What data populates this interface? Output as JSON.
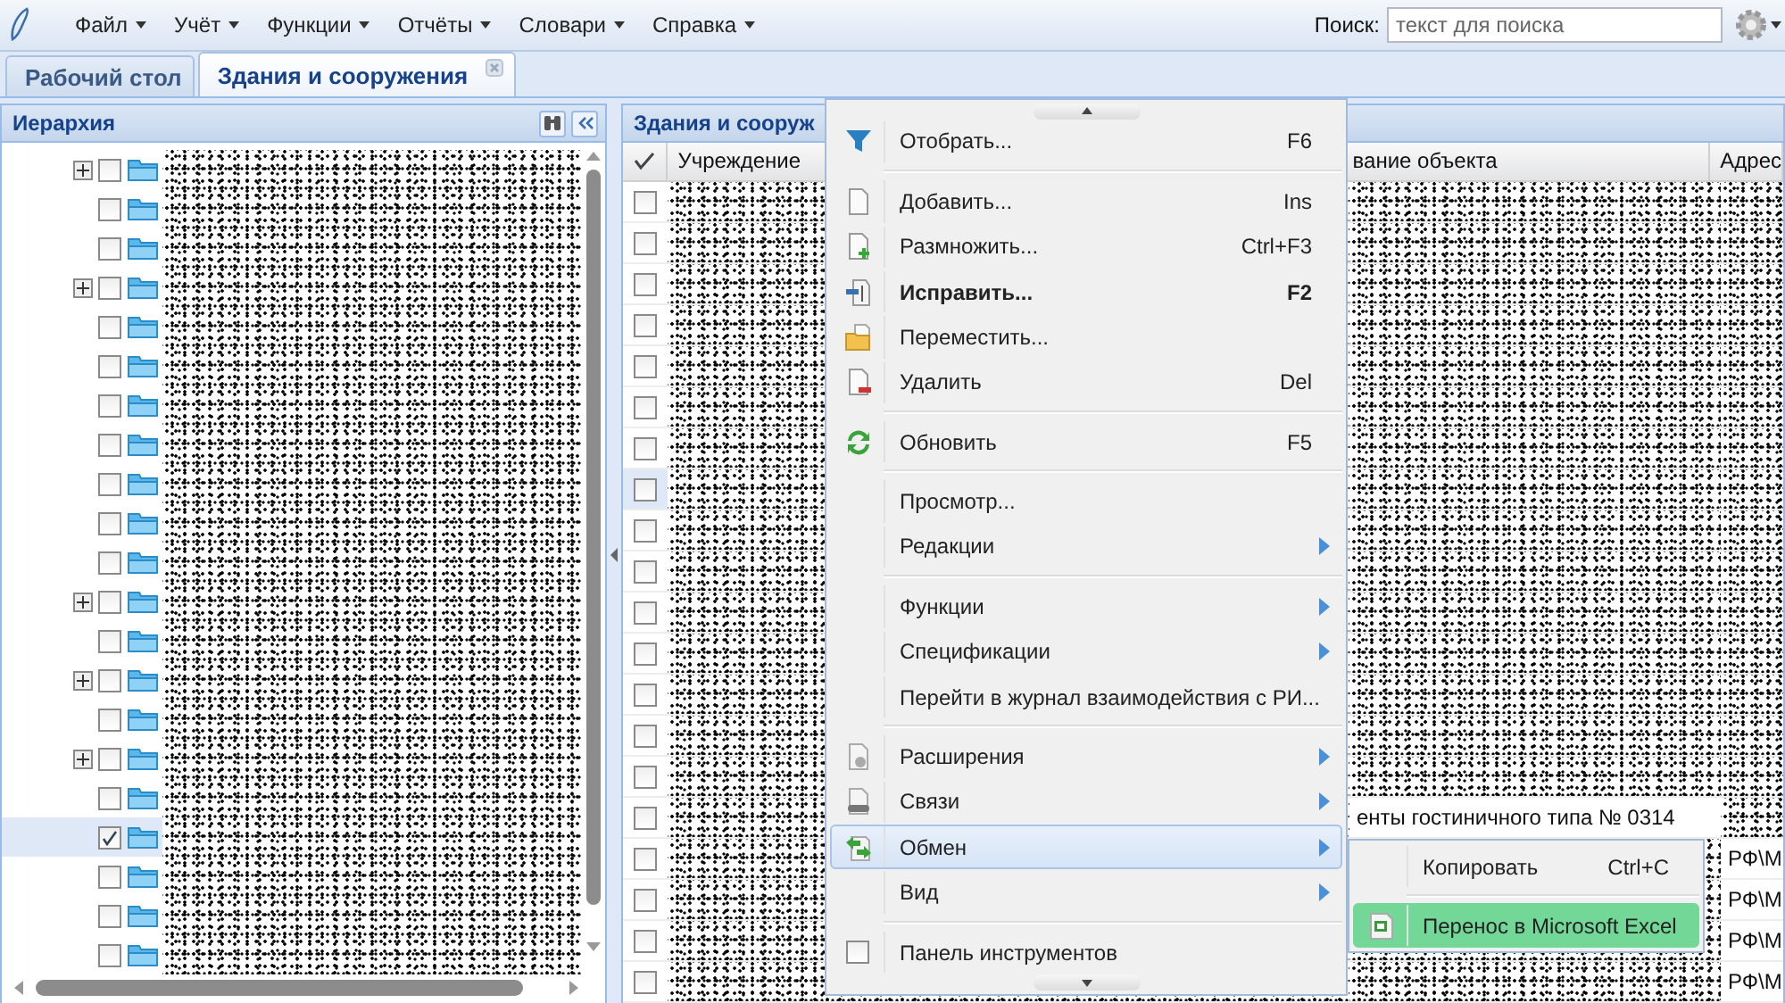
{
  "menubar": {
    "items": [
      "Файл",
      "Учёт",
      "Функции",
      "Отчёты",
      "Словари",
      "Справка"
    ]
  },
  "search": {
    "label": "Поиск:",
    "placeholder": "текст для поиска"
  },
  "tabs": [
    {
      "label": "Рабочий стол",
      "selected": false,
      "closable": false
    },
    {
      "label": "Здания и сооружения",
      "selected": true,
      "closable": true
    }
  ],
  "hierarchy": {
    "title": "Иерархия",
    "rows": [
      {
        "expandable": true,
        "checked": false,
        "selected": false
      },
      {
        "expandable": false,
        "checked": false,
        "selected": false
      },
      {
        "expandable": false,
        "checked": false,
        "selected": false
      },
      {
        "expandable": true,
        "checked": false,
        "selected": false
      },
      {
        "expandable": false,
        "checked": false,
        "selected": false
      },
      {
        "expandable": false,
        "checked": false,
        "selected": false
      },
      {
        "expandable": false,
        "checked": false,
        "selected": false
      },
      {
        "expandable": false,
        "checked": false,
        "selected": false
      },
      {
        "expandable": false,
        "checked": false,
        "selected": false
      },
      {
        "expandable": false,
        "checked": false,
        "selected": false
      },
      {
        "expandable": false,
        "checked": false,
        "selected": false
      },
      {
        "expandable": true,
        "checked": false,
        "selected": false
      },
      {
        "expandable": false,
        "checked": false,
        "selected": false
      },
      {
        "expandable": true,
        "checked": false,
        "selected": false
      },
      {
        "expandable": false,
        "checked": false,
        "selected": false
      },
      {
        "expandable": true,
        "checked": false,
        "selected": false
      },
      {
        "expandable": false,
        "checked": false,
        "selected": false
      },
      {
        "expandable": false,
        "checked": true,
        "selected": true
      },
      {
        "expandable": false,
        "checked": false,
        "selected": false
      },
      {
        "expandable": false,
        "checked": false,
        "selected": false
      },
      {
        "expandable": false,
        "checked": false,
        "selected": false
      }
    ]
  },
  "grid": {
    "title": "Здания и сооруж",
    "columns": [
      "Учреждение",
      "вание объекта",
      "Адрес"
    ],
    "rows": [
      {
        "checked": false,
        "selected": false
      },
      {
        "checked": false,
        "selected": false
      },
      {
        "checked": false,
        "selected": false
      },
      {
        "checked": false,
        "selected": false
      },
      {
        "checked": false,
        "selected": false
      },
      {
        "checked": false,
        "selected": false
      },
      {
        "checked": false,
        "selected": false
      },
      {
        "checked": false,
        "selected": true
      },
      {
        "checked": false,
        "selected": false
      },
      {
        "checked": false,
        "selected": false
      },
      {
        "checked": false,
        "selected": false
      },
      {
        "checked": false,
        "selected": false
      },
      {
        "checked": false,
        "selected": false
      },
      {
        "checked": false,
        "selected": false
      },
      {
        "checked": false,
        "selected": false
      },
      {
        "checked": false,
        "selected": false,
        "name": "енты гостиничного типа № 0314"
      },
      {
        "checked": false,
        "selected": false,
        "address": "РФ\\М"
      },
      {
        "checked": false,
        "selected": false,
        "address": "РФ\\М"
      },
      {
        "checked": false,
        "selected": false,
        "address": "РФ\\М"
      },
      {
        "checked": false,
        "selected": false,
        "address": "РФ\\М"
      }
    ]
  },
  "context_menu": {
    "items": [
      {
        "kind": "item",
        "label": "Отобрать...",
        "shortcut": "F6"
      },
      {
        "kind": "separator"
      },
      {
        "kind": "item",
        "label": "Добавить...",
        "shortcut": "Ins"
      },
      {
        "kind": "item",
        "label": "Размножить...",
        "shortcut": "Ctrl+F3"
      },
      {
        "kind": "item",
        "label": "Исправить...",
        "shortcut": "F2",
        "bold": true
      },
      {
        "kind": "item",
        "label": "Переместить..."
      },
      {
        "kind": "item",
        "label": "Удалить",
        "shortcut": "Del"
      },
      {
        "kind": "separator"
      },
      {
        "kind": "item",
        "label": "Обновить",
        "shortcut": "F5"
      },
      {
        "kind": "separator"
      },
      {
        "kind": "item",
        "label": "Просмотр..."
      },
      {
        "kind": "item",
        "label": "Редакции",
        "submenu": true
      },
      {
        "kind": "separator"
      },
      {
        "kind": "item",
        "label": "Функции",
        "submenu": true
      },
      {
        "kind": "item",
        "label": "Спецификации",
        "submenu": true
      },
      {
        "kind": "item",
        "label": "Перейти в журнал взаимодействия с РИ..."
      },
      {
        "kind": "separator"
      },
      {
        "kind": "item",
        "label": "Расширения",
        "submenu": true
      },
      {
        "kind": "item",
        "label": "Связи",
        "submenu": true
      },
      {
        "kind": "item",
        "label": "Обмен",
        "submenu": true,
        "highlighted": true
      },
      {
        "kind": "item",
        "label": "Вид",
        "submenu": true
      },
      {
        "kind": "separator"
      },
      {
        "kind": "check",
        "label": "Панель инструментов",
        "checked": false
      }
    ]
  },
  "submenu": {
    "items": [
      {
        "kind": "item",
        "label": "Копировать",
        "shortcut": "Ctrl+C",
        "highlighted": false
      },
      {
        "kind": "separator"
      },
      {
        "kind": "item",
        "label": "Перенос в Microsoft Excel",
        "highlighted": true
      }
    ]
  }
}
